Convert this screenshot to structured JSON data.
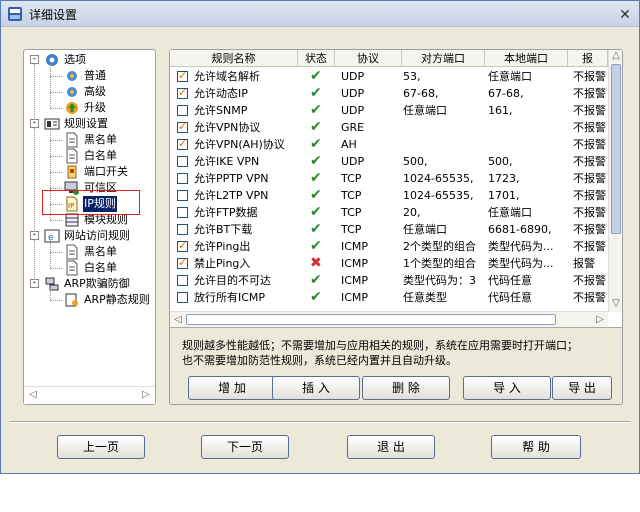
{
  "window": {
    "title": "详细设置"
  },
  "tree": {
    "items": [
      {
        "label": "选项",
        "icon": "options-icon"
      },
      {
        "label": "普通",
        "icon": "gear-icon"
      },
      {
        "label": "高级",
        "icon": "gear-icon"
      },
      {
        "label": "升级",
        "icon": "upgrade-icon"
      },
      {
        "label": "规则设置",
        "icon": "rules-icon"
      },
      {
        "label": "黑名单",
        "icon": "document-icon"
      },
      {
        "label": "白名单",
        "icon": "document-icon"
      },
      {
        "label": "端口开关",
        "icon": "port-icon"
      },
      {
        "label": "可信区",
        "icon": "trusted-icon"
      },
      {
        "label": "IP规则",
        "icon": "ip-rule-icon"
      },
      {
        "label": "模块规则",
        "icon": "module-icon"
      },
      {
        "label": "网站访问规则",
        "icon": "web-icon"
      },
      {
        "label": "黑名单",
        "icon": "document-icon"
      },
      {
        "label": "白名单",
        "icon": "document-icon"
      },
      {
        "label": "ARP欺骗防御",
        "icon": "network-icon"
      },
      {
        "label": "ARP静态规则",
        "icon": "arp-rule-icon"
      }
    ]
  },
  "table": {
    "columns": [
      "规则名称",
      "状态",
      "协议",
      "对方端口",
      "本地端口",
      "报"
    ],
    "rows": [
      {
        "checked": true,
        "name": "允许域名解析",
        "status": "ok",
        "proto": "UDP",
        "remote": "53,",
        "local": "任意端口",
        "act": "不报警"
      },
      {
        "checked": true,
        "name": "允许动态IP",
        "status": "ok",
        "proto": "UDP",
        "remote": "67-68,",
        "local": "67-68,",
        "act": "不报警"
      },
      {
        "checked": false,
        "name": "允许SNMP",
        "status": "ok",
        "proto": "UDP",
        "remote": "任意端口",
        "local": "161,",
        "act": "不报警"
      },
      {
        "checked": true,
        "name": "允许VPN协议",
        "status": "ok",
        "proto": "GRE",
        "remote": "",
        "local": "",
        "act": "不报警"
      },
      {
        "checked": true,
        "name": "允许VPN(AH)协议",
        "status": "ok",
        "proto": "AH",
        "remote": "",
        "local": "",
        "act": "不报警"
      },
      {
        "checked": false,
        "name": "允许IKE VPN",
        "status": "ok",
        "proto": "UDP",
        "remote": "500,",
        "local": "500,",
        "act": "不报警"
      },
      {
        "checked": false,
        "name": "允许PPTP VPN",
        "status": "ok",
        "proto": "TCP",
        "remote": "1024-65535,",
        "local": "1723,",
        "act": "不报警"
      },
      {
        "checked": false,
        "name": "允许L2TP VPN",
        "status": "ok",
        "proto": "TCP",
        "remote": "1024-65535,",
        "local": "1701,",
        "act": "不报警"
      },
      {
        "checked": false,
        "name": "允许FTP数据",
        "status": "ok",
        "proto": "TCP",
        "remote": "20,",
        "local": "任意端口",
        "act": "不报警"
      },
      {
        "checked": false,
        "name": "允许BT下载",
        "status": "ok",
        "proto": "TCP",
        "remote": "任意端口",
        "local": "6681-6890,",
        "act": "不报警"
      },
      {
        "checked": true,
        "name": "允许Ping出",
        "status": "ok",
        "proto": "ICMP",
        "remote": "2个类型的组合",
        "local": "类型代码为...",
        "act": "不报警"
      },
      {
        "checked": true,
        "name": "禁止Ping入",
        "status": "deny",
        "proto": "ICMP",
        "remote": "1个类型的组合",
        "local": "类型代码为...",
        "act": "报警"
      },
      {
        "checked": false,
        "name": "允许目的不可达",
        "status": "ok",
        "proto": "ICMP",
        "remote": "类型代码为：3",
        "local": "代码任意",
        "act": "不报警"
      },
      {
        "checked": false,
        "name": "放行所有ICMP",
        "status": "ok",
        "proto": "ICMP",
        "remote": "任意类型",
        "local": "代码任意",
        "act": "不报警"
      }
    ]
  },
  "note": {
    "line1": "规则越多性能越低；不需要增加与应用相关的规则，系统在应用需要时打开端口；",
    "line2": "也不需要增加防范性规则，系统已经内置并且自动升级。"
  },
  "actions": {
    "add": "增 加",
    "insert": "插 入",
    "delete": "删 除",
    "import": "导 入",
    "export": "导 出"
  },
  "footer": {
    "prev": "上一页",
    "next": "下一页",
    "exit": "退 出",
    "help": "帮 助"
  },
  "colors": {
    "check_ok": "#2a8a2a",
    "deny": "#d03030",
    "selection": "#0a246a",
    "highlight_box": "#e02020"
  }
}
